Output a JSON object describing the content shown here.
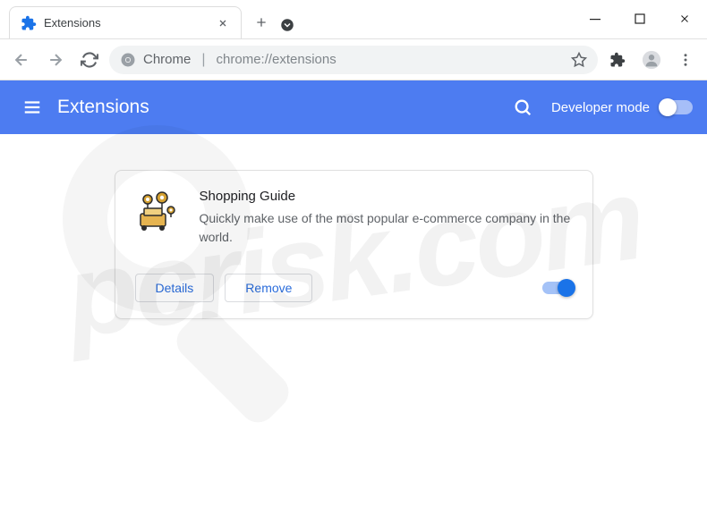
{
  "tab": {
    "title": "Extensions"
  },
  "omnibox": {
    "prefix": "Chrome",
    "url": "chrome://extensions"
  },
  "header": {
    "title": "Extensions",
    "dev_mode_label": "Developer mode"
  },
  "extension": {
    "name": "Shopping Guide",
    "description": "Quickly make use of the most popular e-commerce company in the world.",
    "details_btn": "Details",
    "remove_btn": "Remove"
  },
  "watermark": "pcrisk.com"
}
